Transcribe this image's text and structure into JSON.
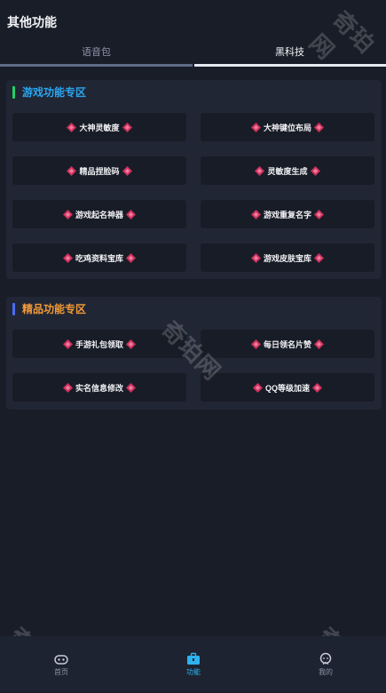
{
  "header": {
    "title": "其他功能"
  },
  "tabs": [
    {
      "label": "语音包",
      "active": false
    },
    {
      "label": "黑科技",
      "active": true
    }
  ],
  "sections": [
    {
      "title": "游戏功能专区",
      "items": [
        "大神灵敏度",
        "大神键位布局",
        "精品捏脸码",
        "灵敏度生成",
        "游戏起名神器",
        "游戏重复名字",
        "吃鸡资料宝库",
        "游戏皮肤宝库"
      ]
    },
    {
      "title": "精品功能专区",
      "items": [
        "手游礼包领取",
        "每日领名片赞",
        "实名信息修改",
        "QQ等级加速"
      ]
    }
  ],
  "watermark": "奇珀网",
  "bottom_nav": [
    {
      "label": "首页",
      "icon": "gamepad-icon",
      "active": false
    },
    {
      "label": "功能",
      "icon": "toolbox-icon",
      "active": true
    },
    {
      "label": "我的",
      "icon": "profile-icon",
      "active": false
    }
  ],
  "colors": {
    "accent_blue": "#2aa6f0",
    "accent_orange": "#f29b38",
    "green_bar": "#21d16b",
    "blue_bar": "#4a6cf2",
    "diamond": "#d0305e"
  }
}
